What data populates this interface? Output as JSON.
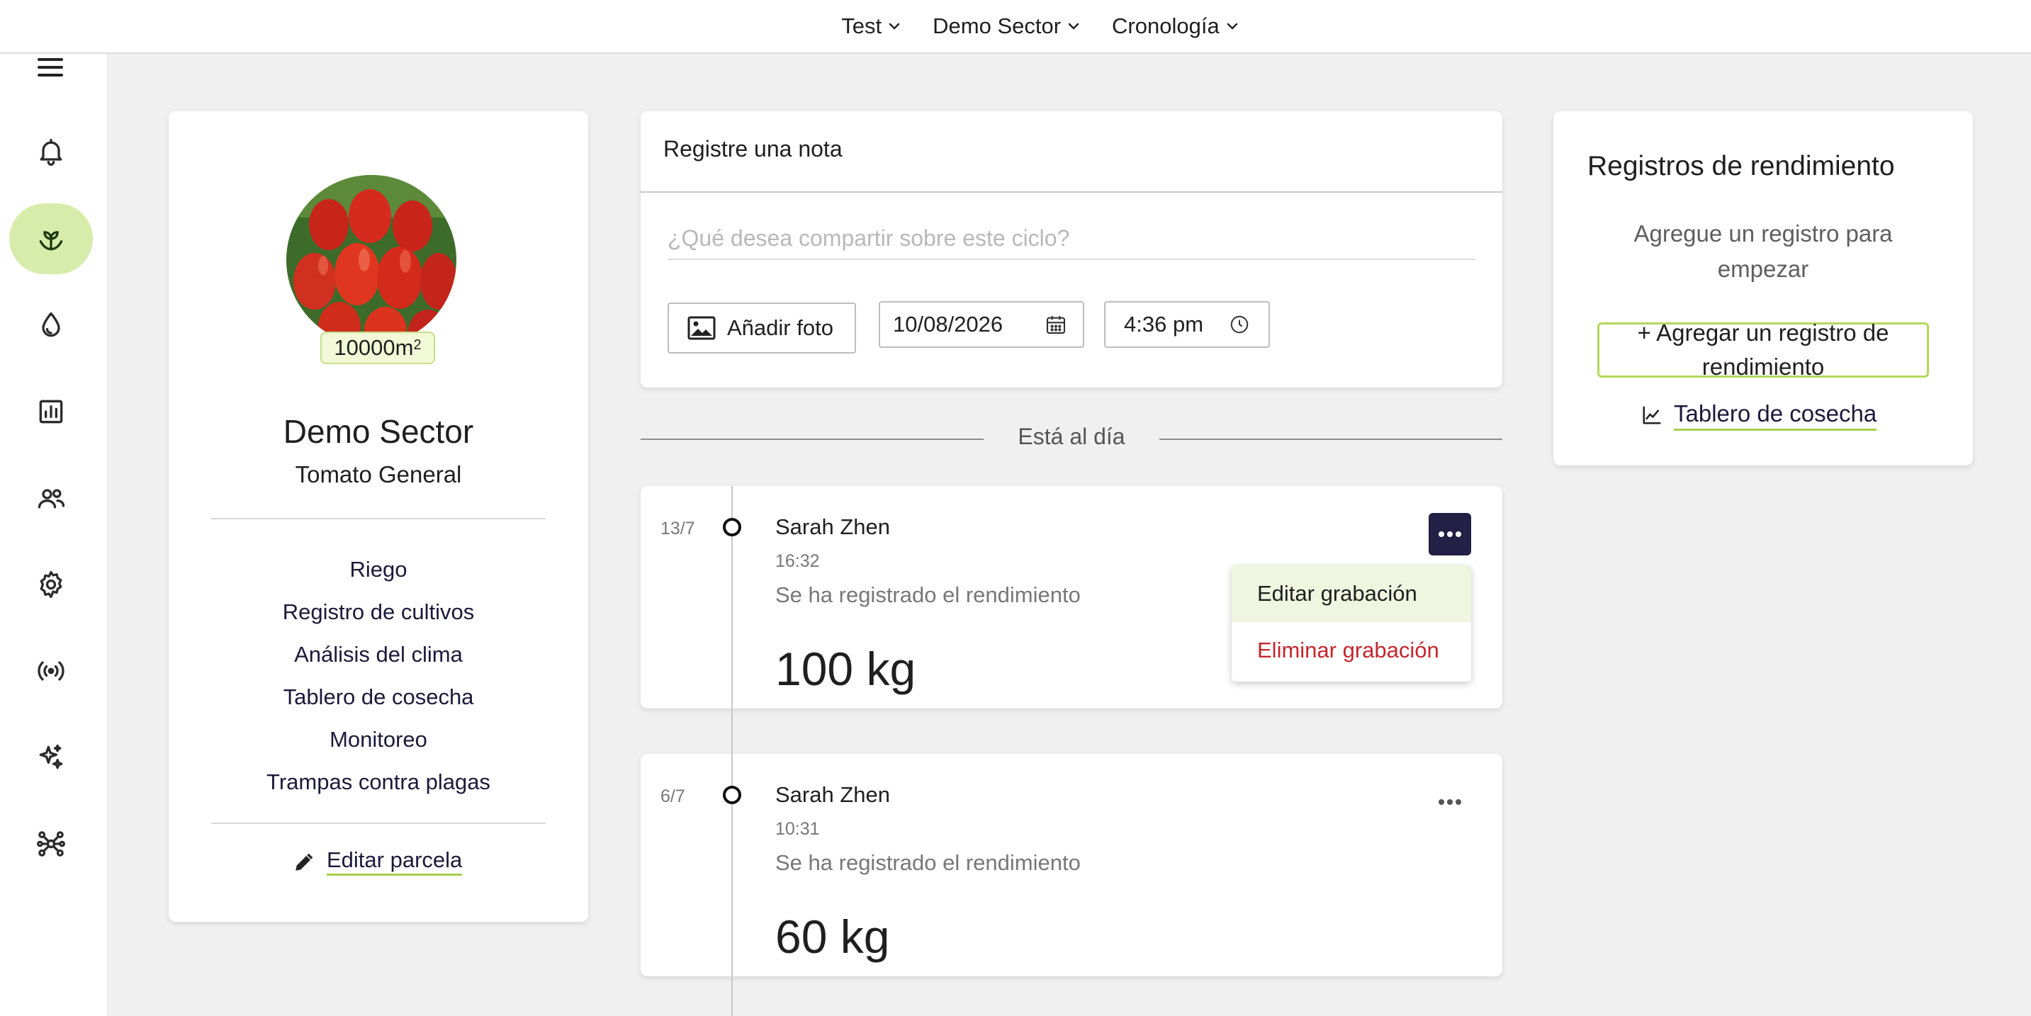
{
  "header": {
    "nav": [
      {
        "label": "Test"
      },
      {
        "label": "Demo Sector"
      },
      {
        "label": "Cronología"
      }
    ]
  },
  "sidebar": {
    "items": [
      {
        "icon": "bell-icon"
      },
      {
        "icon": "crop-sprout-icon",
        "active": true
      },
      {
        "icon": "water-drop-icon"
      },
      {
        "icon": "bar-chart-icon"
      },
      {
        "icon": "people-icon"
      },
      {
        "icon": "gear-icon"
      },
      {
        "icon": "sensor-signal-icon"
      },
      {
        "icon": "sparkles-icon"
      },
      {
        "icon": "network-icon"
      }
    ]
  },
  "plot": {
    "area_value": "10000m",
    "area_unit_exp": "2",
    "name": "Demo Sector",
    "crop": "Tomato General",
    "links": [
      "Riego",
      "Registro de cultivos",
      "Análisis del clima",
      "Tablero de cosecha",
      "Monitoreo",
      "Trampas contra plagas"
    ],
    "edit_label": "Editar parcela"
  },
  "note": {
    "header": "Registre una nota",
    "placeholder": "¿Qué desea compartir sobre este ciclo?",
    "add_photo_label": "Añadir foto",
    "date": "10/08/2026",
    "time": "4:36 pm"
  },
  "timeline": {
    "status": "Está al día",
    "entries": [
      {
        "date": "13/7",
        "user": "Sarah Zhen",
        "time": "16:32",
        "description": "Se ha registrado el rendimiento",
        "value": "100 kg"
      },
      {
        "date": "6/7",
        "user": "Sarah Zhen",
        "time": "10:31",
        "description": "Se ha registrado el rendimiento",
        "value": "60 kg"
      }
    ],
    "menu": {
      "edit_label": "Editar grabación",
      "delete_label": "Eliminar grabación"
    }
  },
  "yield": {
    "title": "Registros de rendimiento",
    "hint": "Agregue un registro para empezar",
    "add_label": "+ Agregar un registro de rendimiento",
    "dashboard_label": "Tablero de cosecha"
  },
  "colors": {
    "accent_green": "#d7ecab",
    "navy": "#232046",
    "danger": "#c4262e"
  }
}
